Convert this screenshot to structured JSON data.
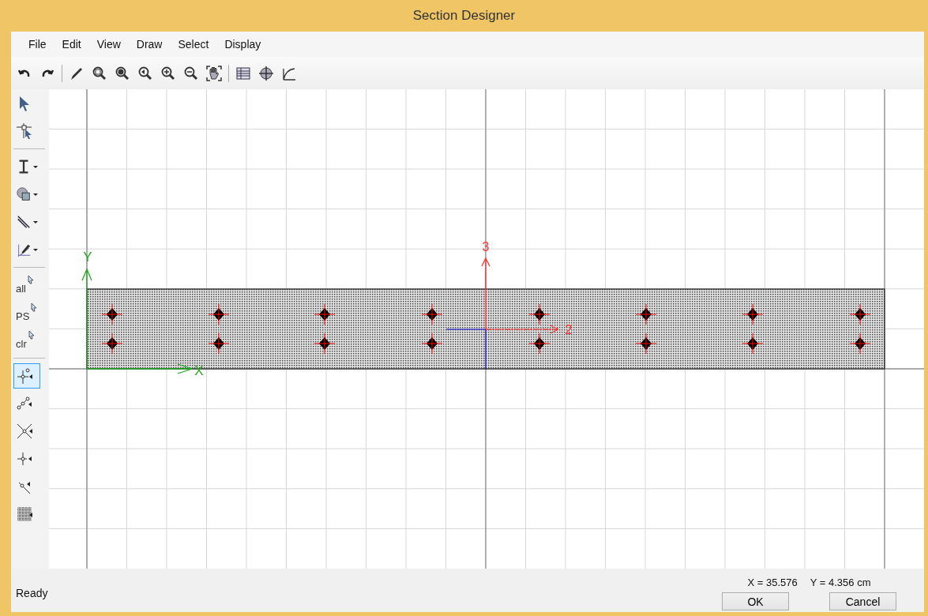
{
  "window": {
    "title": "Section Designer"
  },
  "menu": [
    "File",
    "Edit",
    "View",
    "Draw",
    "Select",
    "Display"
  ],
  "tools": [
    {
      "kind": "pointer",
      "selected": false
    },
    {
      "kind": "reshape",
      "selected": false
    },
    {
      "kind": "separator"
    },
    {
      "kind": "i-section",
      "dropdown": true,
      "selected": false
    },
    {
      "kind": "shape",
      "dropdown": true,
      "selected": false
    },
    {
      "kind": "line",
      "dropdown": true,
      "selected": false
    },
    {
      "kind": "pen",
      "dropdown": true,
      "selected": false
    },
    {
      "kind": "separator"
    },
    {
      "kind": "text-pointer",
      "label": "all",
      "selected": false
    },
    {
      "kind": "text-pointer",
      "label": "PS",
      "selected": false
    },
    {
      "kind": "text-pointer",
      "label": "clr",
      "selected": false
    },
    {
      "kind": "separator"
    },
    {
      "kind": "point",
      "selected": true
    },
    {
      "kind": "point-line",
      "selected": false
    },
    {
      "kind": "point-cross",
      "selected": false
    },
    {
      "kind": "point-single",
      "selected": false
    },
    {
      "kind": "point-edge",
      "selected": false
    },
    {
      "kind": "point-grid",
      "selected": false
    }
  ],
  "canvas": {
    "global_axes": {
      "x_label": "X",
      "y_label": "Y"
    },
    "local_axes": {
      "x_label": "2",
      "y_label": "3"
    }
  },
  "status_bar": {
    "text": "Ready",
    "x_reading": "X = 35.576",
    "y_reading": "Y = 4.356 cm"
  },
  "buttons": [
    "OK",
    "Cancel"
  ]
}
